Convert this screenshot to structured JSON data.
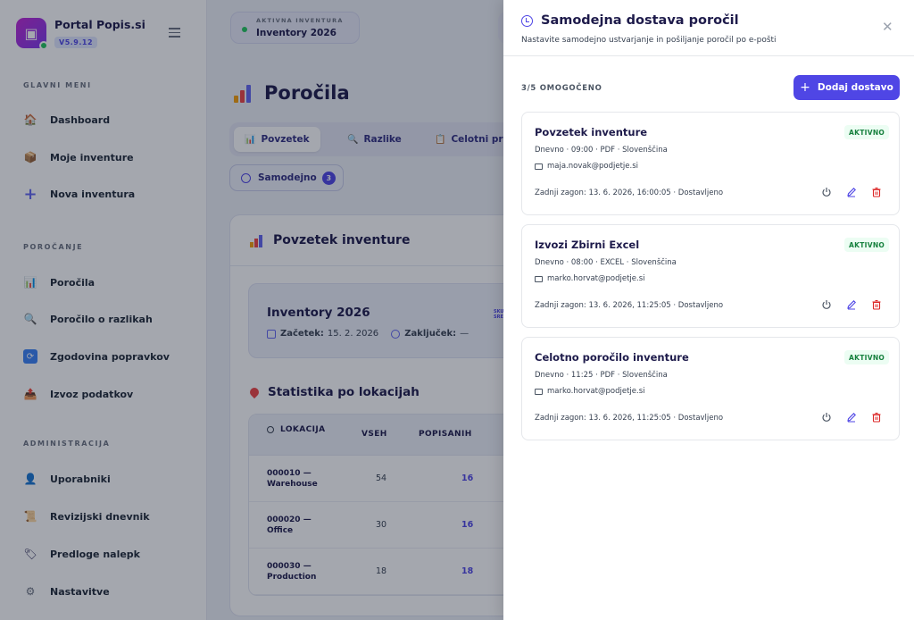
{
  "app": {
    "name": "Portal Popis.si",
    "version": "V5.9.12"
  },
  "sidebar": {
    "sections": [
      {
        "label": "GLAVNI MENI",
        "items": [
          {
            "label": "Dashboard",
            "icon": "home-icon"
          },
          {
            "label": "Moje inventure",
            "icon": "box-icon"
          },
          {
            "label": "Nova inventura",
            "icon": "plus-icon"
          }
        ]
      },
      {
        "label": "POROČANJE",
        "items": [
          {
            "label": "Poročila",
            "icon": "chart-icon"
          },
          {
            "label": "Poročilo o razlikah",
            "icon": "magnifier-icon"
          },
          {
            "label": "Zgodovina popravkov",
            "icon": "refresh-icon"
          },
          {
            "label": "Izvoz podatkov",
            "icon": "export-icon"
          }
        ]
      },
      {
        "label": "ADMINISTRACIJA",
        "items": [
          {
            "label": "Uporabniki",
            "icon": "user-icon"
          },
          {
            "label": "Revizijski dnevnik",
            "icon": "scroll-icon"
          },
          {
            "label": "Predloge nalepk",
            "icon": "tag-icon"
          },
          {
            "label": "Nastavitve",
            "icon": "gear-icon"
          }
        ]
      }
    ]
  },
  "topbar": {
    "active_label": "AKTIVNA INVENTURA",
    "active_value": "Inventory 2026"
  },
  "page": {
    "title": "Poročila"
  },
  "tabs": [
    {
      "label": "Povzetek",
      "icon": "chart-icon"
    },
    {
      "label": "Razlike",
      "icon": "magnifier-icon"
    },
    {
      "label": "Celotni preg",
      "icon": "clipboard-icon"
    }
  ],
  "auto_button": {
    "label": "Samodejno",
    "count": "3"
  },
  "summary": {
    "title": "Povzetek inventure",
    "inventory_name": "Inventory 2026",
    "start_label": "Začetek:",
    "start_value": "15. 2. 2026",
    "end_label": "Zaključek:",
    "end_value": "—",
    "mini_label_1": "SKU",
    "mini_label_2": "SRED"
  },
  "stats": {
    "title": "Statistika po lokacijah",
    "columns": [
      "LOKACIJA",
      "VSEH",
      "POPISANIH"
    ],
    "rows": [
      {
        "location_code": "000010 —",
        "location_name": "Warehouse",
        "all": "54",
        "counted": "16"
      },
      {
        "location_code": "000020 —",
        "location_name": "Office",
        "all": "30",
        "counted": "16"
      },
      {
        "location_code": "000030 —",
        "location_name": "Production",
        "all": "18",
        "counted": "18"
      }
    ]
  },
  "drawer": {
    "title": "Samodejna dostava poročil",
    "subtitle": "Nastavite samodejno ustvarjanje in pošiljanje poročil po e-pošti",
    "enabled_text": "3/5 OMOGOČENO",
    "add_label": "Dodaj dostavo",
    "deliveries": [
      {
        "name": "Povzetek inventure",
        "status": "AKTIVNO",
        "schedule": "Dnevno · 09:00 · PDF · Slovenščina",
        "email": "maja.novak@podjetje.si",
        "last_run": "Zadnji zagon: 13. 6. 2026, 16:00:05 · Dostavljeno"
      },
      {
        "name": "Izvozi Zbirni Excel",
        "status": "AKTIVNO",
        "schedule": "Dnevno · 08:00 · EXCEL · Slovenščina",
        "email": "marko.horvat@podjetje.si",
        "last_run": "Zadnji zagon: 13. 6. 2026, 11:25:05 · Dostavljeno"
      },
      {
        "name": "Celotno poročilo inventure",
        "status": "AKTIVNO",
        "schedule": "Dnevno · 11:25 · PDF · Slovenščina",
        "email": "marko.horvat@podjetje.si",
        "last_run": "Zadnji zagon: 13. 6. 2026, 11:25:05 · Dostavljeno"
      }
    ]
  },
  "colors": {
    "accent": "#4f46e5",
    "active_green": "#15803d",
    "danger": "#dc2626"
  }
}
